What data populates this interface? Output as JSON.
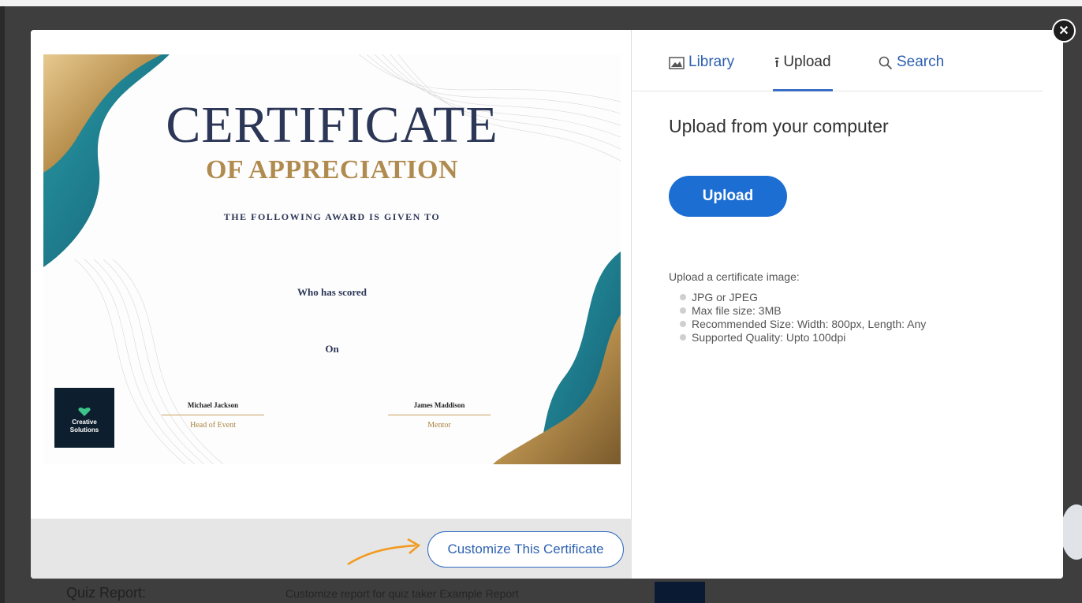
{
  "background": {
    "report_label": "Quiz Report:",
    "report_text": "Customize report for quiz taker   Example Report"
  },
  "tabs": [
    {
      "label": "Library",
      "icon": "image-icon"
    },
    {
      "label": "Upload",
      "icon": "upload-arrow-icon"
    },
    {
      "label": "Search",
      "icon": "search-icon"
    }
  ],
  "upload": {
    "heading": "Upload from your computer",
    "button_label": "Upload",
    "info_label": "Upload a certificate image:",
    "requirements": [
      "JPG or JPEG",
      "Max file size: 3MB",
      "Recommended Size: Width: 800px, Length: Any",
      "Supported Quality: Upto 100dpi"
    ]
  },
  "certificate": {
    "title": "CERTIFICATE",
    "subtitle": "OF APPRECIATION",
    "given_to": "THE FOLLOWING AWARD IS GIVEN TO",
    "scored": "Who has scored",
    "on": "On",
    "signer1_name": "Michael Jackson",
    "signer1_role": "Head of Event",
    "signer2_name": "James Maddison",
    "signer2_role": "Mentor",
    "logo_text_line1": "Creative",
    "logo_text_line2": "Solutions"
  },
  "customize_button": "Customize This Certificate",
  "close_icon": "close-icon",
  "colors": {
    "primary": "#1c6ed3",
    "gold": "#b08b4f",
    "navy": "#2c3657",
    "teal": "#1e7f8c"
  }
}
